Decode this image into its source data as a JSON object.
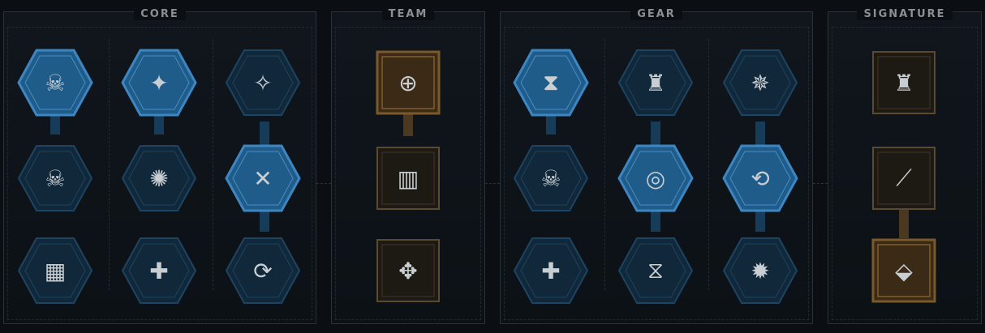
{
  "panels": {
    "core": {
      "title": "CORE"
    },
    "team": {
      "title": "TEAM"
    },
    "gear": {
      "title": "GEAR"
    },
    "signature": {
      "title": "SIGNATURE"
    }
  },
  "colors": {
    "active_blue": "#1f5c8a",
    "inactive_blue": "#10283a",
    "gold": "#7a5a2a"
  },
  "perks": [
    {
      "panel": "core",
      "col": 0,
      "row": 0,
      "shape": "hex",
      "state": "active",
      "icon": "squad-skull-shield-icon"
    },
    {
      "panel": "core",
      "col": 1,
      "row": 0,
      "shape": "hex",
      "state": "active",
      "icon": "weapon-rank-up-icon"
    },
    {
      "panel": "core",
      "col": 2,
      "row": 0,
      "shape": "hex",
      "state": "inactive",
      "icon": "melee-strike-icon"
    },
    {
      "panel": "core",
      "col": 0,
      "row": 1,
      "shape": "hex",
      "state": "inactive",
      "icon": "squad-ammo-icon"
    },
    {
      "panel": "core",
      "col": 1,
      "row": 1,
      "shape": "hex",
      "state": "inactive",
      "icon": "aquila-burst-icon"
    },
    {
      "panel": "core",
      "col": 2,
      "row": 1,
      "shape": "hex",
      "state": "active",
      "icon": "crossed-weapons-icon"
    },
    {
      "panel": "core",
      "col": 0,
      "row": 2,
      "shape": "hex",
      "state": "inactive",
      "icon": "squad-crate-icon"
    },
    {
      "panel": "core",
      "col": 1,
      "row": 2,
      "shape": "hex",
      "state": "inactive",
      "icon": "aquila-weight-icon"
    },
    {
      "panel": "core",
      "col": 2,
      "row": 2,
      "shape": "hex",
      "state": "inactive",
      "icon": "pistol-reload-icon"
    },
    {
      "panel": "team",
      "col": 0,
      "row": 0,
      "shape": "square",
      "state": "active",
      "icon": "squad-target-icon"
    },
    {
      "panel": "team",
      "col": 0,
      "row": 1,
      "shape": "square",
      "state": "inactive",
      "icon": "ammo-rank-up-icon"
    },
    {
      "panel": "team",
      "col": 0,
      "row": 2,
      "shape": "square",
      "state": "inactive",
      "icon": "aquila-emblem-icon"
    },
    {
      "panel": "gear",
      "col": 0,
      "row": 0,
      "shape": "hex",
      "state": "active",
      "icon": "shield-hourglass-icon"
    },
    {
      "panel": "gear",
      "col": 1,
      "row": 0,
      "shape": "hex",
      "state": "inactive",
      "icon": "armor-shield-icon"
    },
    {
      "panel": "gear",
      "col": 2,
      "row": 0,
      "shape": "hex",
      "state": "inactive",
      "icon": "winged-rank-icon"
    },
    {
      "panel": "gear",
      "col": 0,
      "row": 1,
      "shape": "hex",
      "state": "inactive",
      "icon": "squad-ammo-arrows-icon"
    },
    {
      "panel": "gear",
      "col": 1,
      "row": 1,
      "shape": "hex",
      "state": "active",
      "icon": "shield-cycle-icon"
    },
    {
      "panel": "gear",
      "col": 2,
      "row": 1,
      "shape": "hex",
      "state": "active",
      "icon": "rank-cycle-icon"
    },
    {
      "panel": "gear",
      "col": 0,
      "row": 2,
      "shape": "hex",
      "state": "inactive",
      "icon": "shield-plus-icon"
    },
    {
      "panel": "gear",
      "col": 1,
      "row": 2,
      "shape": "hex",
      "state": "inactive",
      "icon": "shield-hourglass-small-icon"
    },
    {
      "panel": "gear",
      "col": 2,
      "row": 2,
      "shape": "hex",
      "state": "inactive",
      "icon": "explosion-icon"
    },
    {
      "panel": "signature",
      "col": 0,
      "row": 0,
      "shape": "square",
      "state": "inactive",
      "icon": "armor-aura-icon"
    },
    {
      "panel": "signature",
      "col": 0,
      "row": 1,
      "shape": "square",
      "state": "inactive",
      "icon": "weapon-slash-icon"
    },
    {
      "panel": "signature",
      "col": 0,
      "row": 2,
      "shape": "square",
      "state": "active",
      "icon": "rank-shield-icon"
    }
  ]
}
